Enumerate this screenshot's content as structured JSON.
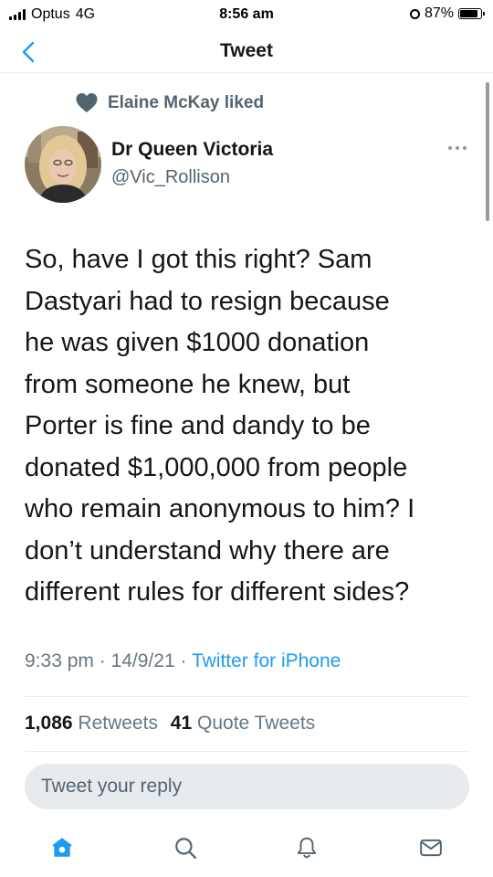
{
  "status_bar": {
    "carrier": "Optus",
    "network": "4G",
    "time": "8:56 am",
    "battery_percent_label": "87%",
    "battery_level": 0.87
  },
  "nav": {
    "back_icon": "chevron-left-icon",
    "title": "Tweet"
  },
  "social_context": {
    "icon": "heart-icon",
    "text": "Elaine McKay liked"
  },
  "author": {
    "display_name": "Dr Queen Victoria",
    "handle": "@Vic_Rollison"
  },
  "tweet": {
    "text": "So, have I got this right? Sam\nDastyari had to resign because\nhe was given $1000 donation\nfrom someone he knew, but\nPorter is fine and dandy to be\ndonated $1,000,000 from people\nwho remain anonymous to him? I\ndon’t understand why there are\ndifferent rules for different sides?",
    "time": "9:33 pm",
    "date": "14/9/21",
    "source": "Twitter for iPhone"
  },
  "stats": {
    "retweets_count": "1,086",
    "retweets_label": "Retweets",
    "quotes_count": "41",
    "quotes_label": "Quote Tweets"
  },
  "reply": {
    "placeholder": "Tweet your reply"
  },
  "tab_bar": {
    "items": [
      {
        "name": "home",
        "icon": "home-icon",
        "active": true
      },
      {
        "name": "search",
        "icon": "search-icon",
        "active": false
      },
      {
        "name": "notifications",
        "icon": "bell-icon",
        "active": false
      },
      {
        "name": "messages",
        "icon": "mail-icon",
        "active": false
      }
    ]
  },
  "colors": {
    "accent": "#1d9bf0",
    "text_primary": "#14171a",
    "text_secondary": "#536471",
    "divider": "#e6ecf0"
  }
}
